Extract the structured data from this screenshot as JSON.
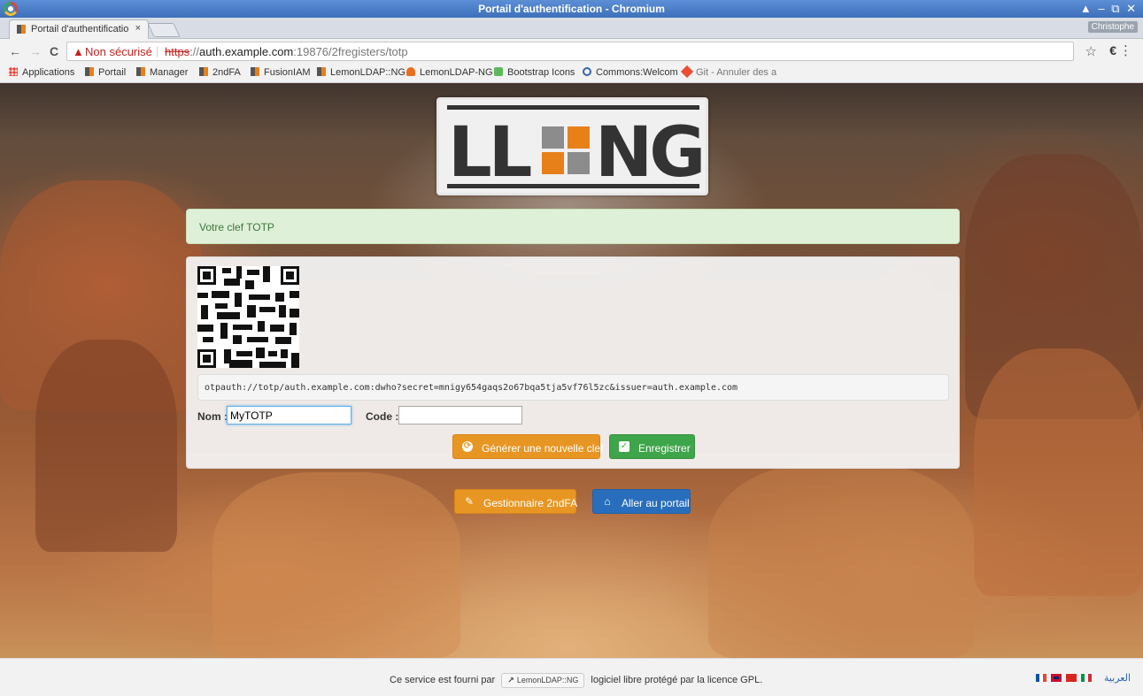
{
  "window": {
    "title": "Portail d'authentification - Chromium",
    "controls": "▲ ‒ ⧉ ✕",
    "profile": "Christophe"
  },
  "tab": {
    "label": "Portail d'authentificatio",
    "close": "×"
  },
  "toolbar": {
    "back": "←",
    "forward": "→",
    "reload": "C",
    "security_icon": "▲",
    "security_label": "Non sécurisé",
    "url_scheme": "https",
    "url_sep": "://",
    "url_host": "auth.example.com",
    "url_path": ":19876/2fregisters/totp",
    "bookmark_star": "☆",
    "extension": "€",
    "menu": "⋮"
  },
  "bookmarks": [
    {
      "label": "Applications",
      "icon": "apps-icon"
    },
    {
      "label": "Portail",
      "icon": "lemonldap-icon"
    },
    {
      "label": "Manager",
      "icon": "lemonldap-icon"
    },
    {
      "label": "2ndFA",
      "icon": "lemonldap-icon"
    },
    {
      "label": "FusionIAM",
      "icon": "lemonldap-icon"
    },
    {
      "label": "LemonLDAP::NG",
      "icon": "lemonldap-icon"
    },
    {
      "label": "LemonLDAP-NG",
      "icon": "gitlab-icon"
    },
    {
      "label": "Bootstrap Icons",
      "icon": "bootstrap-icon"
    },
    {
      "label": "Commons:Welcom",
      "icon": "commons-icon"
    },
    {
      "label": "Git - Annuler des a",
      "icon": "git-icon"
    }
  ],
  "logo": {
    "text_left": "LL",
    "text_right": "NG"
  },
  "alert": {
    "message": "Votre clef TOTP"
  },
  "totp": {
    "uri": "otpauth://totp/auth.example.com:dwho?secret=mnigy654gaqs2o67bqa5tja5vf76l5zc&issuer=auth.example.com",
    "name_label": "Nom :",
    "name_value": "MyTOTP",
    "code_label": "Code :",
    "code_value": "",
    "generate_label": "Générer une nouvelle clef",
    "save_label": "Enregistrer"
  },
  "nav": {
    "manager_label": "Gestionnaire 2ndFA",
    "portal_label": "Aller au portail"
  },
  "footer": {
    "prefix": "Ce service est fourni par",
    "product": "LemonLDAP::NG",
    "suffix": "logiciel libre protégé par la licence GPL.",
    "arabic": "العربية"
  },
  "colors": {
    "orange": "#e89623",
    "green": "#3fa54a",
    "blue": "#286ebd",
    "alert_bg": "#dff0d8"
  }
}
